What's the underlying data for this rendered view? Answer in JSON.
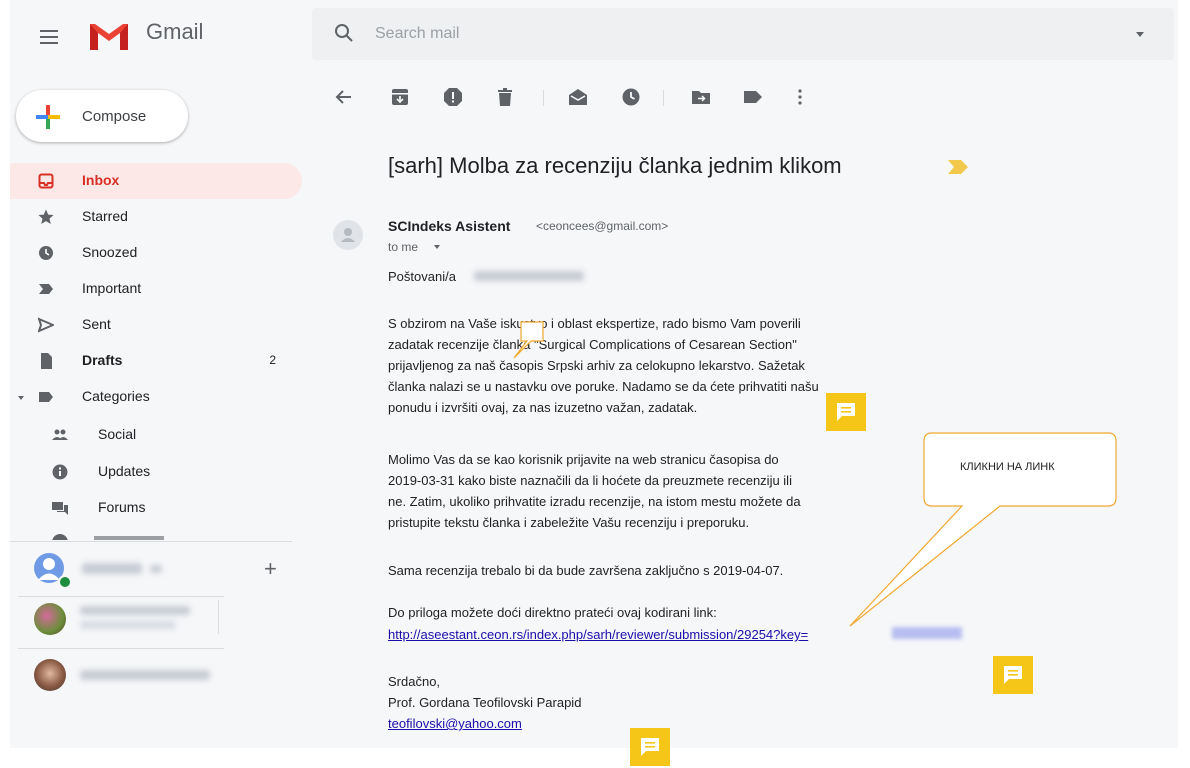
{
  "header": {
    "brand": "Gmail",
    "search_placeholder": "Search mail"
  },
  "sidebar": {
    "compose_label": "Compose",
    "items": [
      {
        "label": "Inbox",
        "icon": "inbox-icon"
      },
      {
        "label": "Starred",
        "icon": "star-icon"
      },
      {
        "label": "Snoozed",
        "icon": "clock-icon"
      },
      {
        "label": "Important",
        "icon": "important-icon"
      },
      {
        "label": "Sent",
        "icon": "send-icon"
      },
      {
        "label": "Drafts",
        "icon": "draft-icon",
        "count": "2"
      },
      {
        "label": "Categories",
        "icon": "label-icon"
      },
      {
        "label": "Social",
        "icon": "people-icon"
      },
      {
        "label": "Updates",
        "icon": "info-icon"
      },
      {
        "label": "Forums",
        "icon": "forum-icon"
      }
    ]
  },
  "message": {
    "subject": "[sarh] Molba za recenziju članka jednim klikom",
    "sender_name": "SCIndeks Asistent",
    "sender_email": "<ceoncees@gmail.com>",
    "recipient": "to me",
    "greeting": "Poštovani/a",
    "p1_lines": [
      "S obzirom na Vaše iskustvo i oblast ekspertize, rado bismo Vam poverili",
      "zadatak recenzije članka \"Surgical Complications of Cesarean Section\"",
      "prijavljenog za naš časopis Srpski arhiv za celokupno lekarstvo. Sažetak",
      "članka nalazi se u nastavku ove poruke. Nadamo se da ćete prihvatiti našu",
      "ponudu i izvršiti ovaj, za nas izuzetno važan, zadatak."
    ],
    "p2_lines": [
      "Molimo Vas da se kao korisnik prijavite na web stranicu časopisa do",
      "2019-03-31 kako biste naznačili da li hoćete da preuzmete recenziju ili",
      "ne. Zatim, ukoliko prihvatite izradu recenzije, na istom mestu možete da",
      "pristupite tekstu članka i zabeležite Vašu recenziju i preporuku."
    ],
    "p3": "Sama recenzija trebalo bi da bude završena zaključno s 2019-04-07.",
    "p4": "Do priloga možete doći direktno prateći ovaj kodirani link:",
    "link": "http://aseestant.ceon.rs/index.php/sarh/reviewer/submission/29254?key=",
    "signoff": "Srdačno,",
    "signature": "Prof. Gordana Teofilovski Parapid",
    "signature_email": "teofilovski@yahoo.com"
  },
  "annotation": {
    "callout": "КЛИКНИ НА ЛИНК"
  },
  "colors": {
    "accent_red": "#d93025",
    "note_yellow": "#f5c518",
    "link_blue": "#1a0dab"
  }
}
